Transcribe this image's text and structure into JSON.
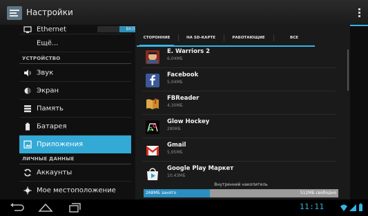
{
  "action_bar": {
    "title": "Настройки"
  },
  "left_pane": {
    "ethernet": {
      "label": "Ethernet",
      "toggle": "ВКЛ"
    },
    "more": "Ещё...",
    "section_device": "УСТРОЙСТВО",
    "items_device": [
      {
        "label": "Звук",
        "icon": "volume-icon"
      },
      {
        "label": "Экран",
        "icon": "display-icon"
      },
      {
        "label": "Память",
        "icon": "storage-icon"
      },
      {
        "label": "Батарея",
        "icon": "battery-icon"
      },
      {
        "label": "Приложения",
        "icon": "apps-icon",
        "selected": true
      }
    ],
    "section_personal": "ЛИЧНЫЕ ДАННЫЕ",
    "items_personal": [
      {
        "label": "Аккаунты",
        "icon": "sync-icon"
      },
      {
        "label": "Мое местоположение",
        "icon": "location-icon"
      }
    ]
  },
  "tabs": [
    {
      "label": "СТОРОННИЕ",
      "active": true
    },
    {
      "label": "НА SD-КАРТЕ"
    },
    {
      "label": "РАБОТАЮЩИЕ"
    },
    {
      "label": "ВСЕ"
    }
  ],
  "apps": [
    {
      "name": "E. Warriors 2",
      "size": "6,04МБ",
      "icon": "e-warriors-icon"
    },
    {
      "name": "Facebook",
      "size": "5,04МБ",
      "icon": "facebook-icon"
    },
    {
      "name": "FBReader",
      "size": "4,30МБ",
      "icon": "fbreader-icon"
    },
    {
      "name": "Glow Hockey",
      "size": "280КБ",
      "icon": "glow-hockey-icon"
    },
    {
      "name": "Gmail",
      "size": "5,95МБ",
      "icon": "gmail-icon"
    },
    {
      "name": "Google Play Маркет",
      "size": "10,43МБ",
      "icon": "play-store-icon"
    }
  ],
  "storage": {
    "title": "Внутренний накопитель",
    "used_label": "268МБ занято",
    "free_label": "512МБ свободно",
    "used_fraction": 0.34
  },
  "status_bar": {
    "time": "11:11"
  },
  "colors": {
    "accent": "#33b5e5",
    "selected": "#33a9d6",
    "storage_used": "#2b8ec0"
  }
}
